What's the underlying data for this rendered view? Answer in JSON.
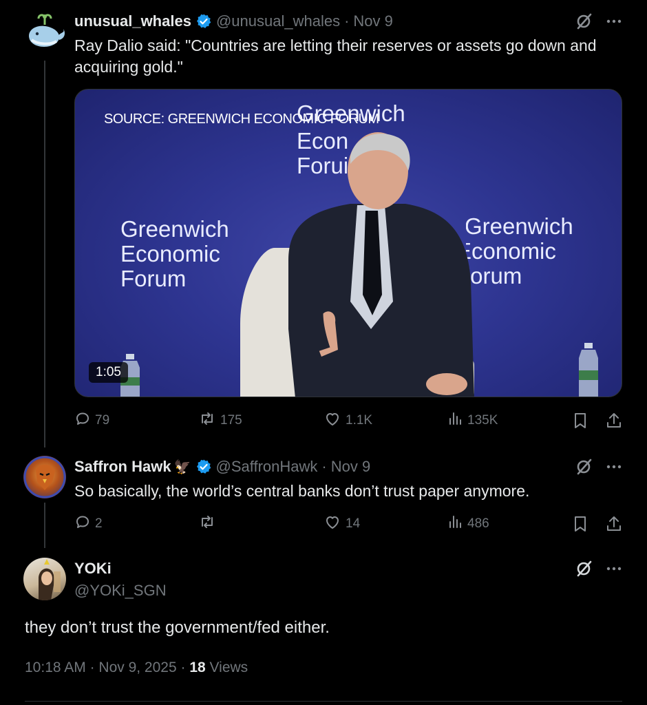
{
  "tweet1": {
    "display_name": "unusual_whales",
    "handle": "@unusual_whales",
    "date": "Nov 9",
    "text": "Ray Dalio said: \"Countries are letting their reserves or assets go down and acquiring gold.\"",
    "media": {
      "source_caption": "SOURCE: GREENWICH ECONOMIC FORUM",
      "backdrop_center": [
        "Greenwich",
        "Econ",
        "Forui"
      ],
      "backdrop_left": [
        "Greenwich",
        "Economic",
        "Forum"
      ],
      "backdrop_right": [
        "Greenwich",
        "Economic",
        "Forum"
      ],
      "duration": "1:05"
    },
    "stats": {
      "replies": "79",
      "reposts": "175",
      "likes": "1.1K",
      "views": "135K"
    }
  },
  "tweet2": {
    "display_name": "Saffron Hawk",
    "emoji": "🦅",
    "handle": "@SaffronHawk",
    "date": "Nov 9",
    "text": "So basically, the world’s central banks don’t trust paper anymore.",
    "stats": {
      "replies": "2",
      "reposts": "",
      "likes": "14",
      "views": "486"
    }
  },
  "main": {
    "display_name": "YOKi",
    "handle": "@YOKi_SGN",
    "text": "they don’t trust the government/fed either.",
    "time": "10:18 AM",
    "date": "Nov 9, 2025",
    "views_count": "18",
    "views_label": "Views"
  },
  "icons": {
    "grok": "grok-icon",
    "more": "more-icon",
    "reply": "reply-icon",
    "repost": "repost-icon",
    "like": "like-icon",
    "views": "views-icon",
    "bookmark": "bookmark-icon",
    "share": "share-icon",
    "verified": "verified-badge-icon"
  },
  "colors": {
    "background": "#000000",
    "text": "#e7e9ea",
    "muted": "#71767b",
    "verified": "#1d9bf0"
  }
}
